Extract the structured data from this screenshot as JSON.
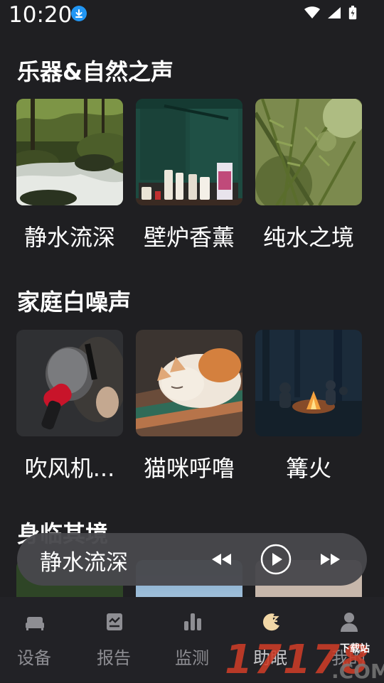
{
  "status": {
    "time": "10:20"
  },
  "sections": [
    {
      "title": "乐器&自然之声",
      "items": [
        {
          "label": "静水流深",
          "image": "forest-stream"
        },
        {
          "label": "壁炉香薰",
          "image": "candles-fireplace"
        },
        {
          "label": "纯水之境",
          "image": "pine-branches"
        }
      ]
    },
    {
      "title": "家庭白噪声",
      "items": [
        {
          "label": "吹风机...",
          "image": "hair-dryer"
        },
        {
          "label": "猫咪呼噜",
          "image": "sleeping-cat"
        },
        {
          "label": "篝火",
          "image": "campfire"
        }
      ]
    },
    {
      "title": "身临其境",
      "items": []
    }
  ],
  "player": {
    "title": "静水流深"
  },
  "nav": {
    "active": "助眠",
    "items": [
      {
        "label": "设备",
        "icon": "bed-icon"
      },
      {
        "label": "报告",
        "icon": "report-icon"
      },
      {
        "label": "监测",
        "icon": "bar-chart-icon"
      },
      {
        "label": "助眠",
        "icon": "moon-icon"
      },
      {
        "label": "我的",
        "icon": "person-icon"
      }
    ]
  },
  "watermark": {
    "number": "17178",
    "top": "下载站",
    "suffix": ".COM"
  },
  "colors": {
    "background": "#1f1f22",
    "player": "#48484c",
    "accent_download": "#2196f3",
    "watermark": "#cd3c28"
  }
}
